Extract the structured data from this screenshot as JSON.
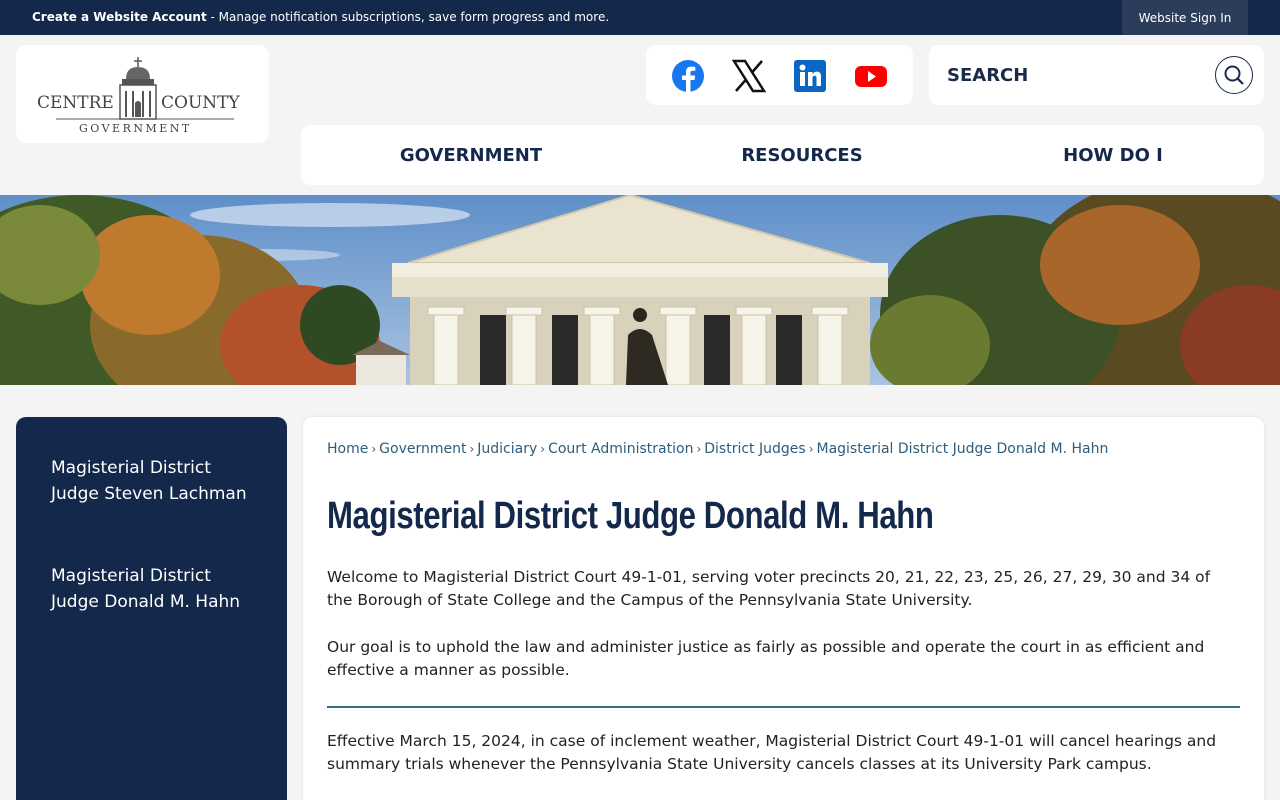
{
  "topbar": {
    "account_bold": "Create a Website Account",
    "account_rest": " - Manage notification subscriptions, save form progress and more.",
    "signin_label": "Website Sign In"
  },
  "logo": {
    "line1_left": "CENTRE",
    "line1_right": "COUNTY",
    "line2": "GOVERNMENT"
  },
  "social": [
    "facebook-icon",
    "x-twitter-icon",
    "linkedin-icon",
    "youtube-icon"
  ],
  "search": {
    "placeholder": "SEARCH"
  },
  "nav": {
    "items": [
      "GOVERNMENT",
      "RESOURCES",
      "HOW DO I"
    ]
  },
  "sidebar": {
    "items": [
      "Magisterial District Judge Steven Lachman",
      "Magisterial District Judge Donald M. Hahn"
    ]
  },
  "breadcrumb": {
    "items": [
      "Home",
      "Government",
      "Judiciary",
      "Court Administration",
      "District Judges",
      "Magisterial District Judge Donald M. Hahn"
    ],
    "separator": "›"
  },
  "page": {
    "title": "Magisterial District Judge Donald M. Hahn",
    "para1": "Welcome to Magisterial District Court 49-1-01, serving voter precincts 20, 21, 22, 23, 25, 26, 27, 29, 30 and 34 of the Borough of State College and the Campus of the Pennsylvania State University.",
    "para2": "Our goal is to uphold the law and administer justice as fairly as possible and operate the court in as efficient and effective a manner as possible.",
    "para3": "Effective March 15, 2024, in case of inclement weather, Magisterial District Court 49-1-01 will cancel hearings and summary trials whenever the Pennsylvania State University cancels classes at its University Park campus."
  },
  "colors": {
    "navy": "#13284a",
    "link": "#2f5d7c",
    "rule": "#3c6e82",
    "facebook": "#1877f2",
    "linkedin": "#0a66c2",
    "youtube": "#ff0000"
  }
}
